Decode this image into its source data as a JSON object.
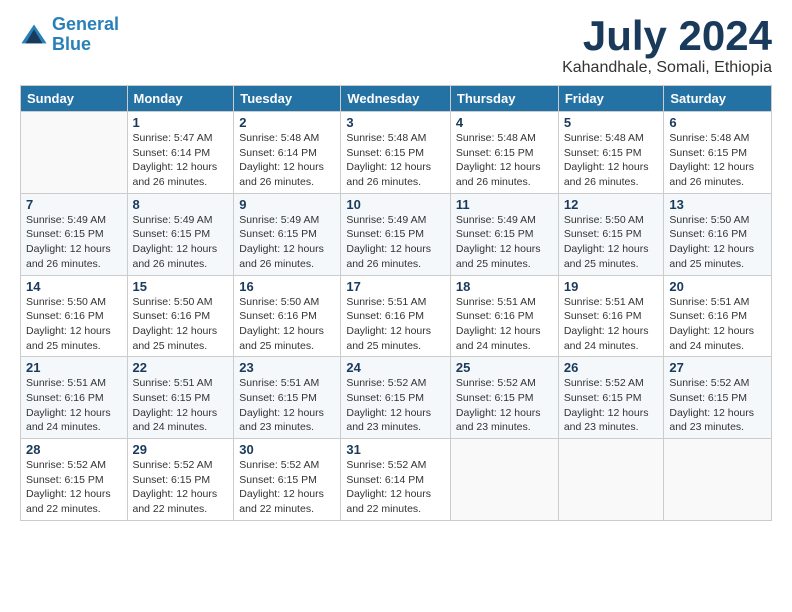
{
  "logo": {
    "line1": "General",
    "line2": "Blue"
  },
  "title": "July 2024",
  "subtitle": "Kahandhale, Somali, Ethiopia",
  "weekdays": [
    "Sunday",
    "Monday",
    "Tuesday",
    "Wednesday",
    "Thursday",
    "Friday",
    "Saturday"
  ],
  "weeks": [
    [
      {
        "day": "",
        "info": ""
      },
      {
        "day": "1",
        "info": "Sunrise: 5:47 AM\nSunset: 6:14 PM\nDaylight: 12 hours\nand 26 minutes."
      },
      {
        "day": "2",
        "info": "Sunrise: 5:48 AM\nSunset: 6:14 PM\nDaylight: 12 hours\nand 26 minutes."
      },
      {
        "day": "3",
        "info": "Sunrise: 5:48 AM\nSunset: 6:15 PM\nDaylight: 12 hours\nand 26 minutes."
      },
      {
        "day": "4",
        "info": "Sunrise: 5:48 AM\nSunset: 6:15 PM\nDaylight: 12 hours\nand 26 minutes."
      },
      {
        "day": "5",
        "info": "Sunrise: 5:48 AM\nSunset: 6:15 PM\nDaylight: 12 hours\nand 26 minutes."
      },
      {
        "day": "6",
        "info": "Sunrise: 5:48 AM\nSunset: 6:15 PM\nDaylight: 12 hours\nand 26 minutes."
      }
    ],
    [
      {
        "day": "7",
        "info": "Sunrise: 5:49 AM\nSunset: 6:15 PM\nDaylight: 12 hours\nand 26 minutes."
      },
      {
        "day": "8",
        "info": "Sunrise: 5:49 AM\nSunset: 6:15 PM\nDaylight: 12 hours\nand 26 minutes."
      },
      {
        "day": "9",
        "info": "Sunrise: 5:49 AM\nSunset: 6:15 PM\nDaylight: 12 hours\nand 26 minutes."
      },
      {
        "day": "10",
        "info": "Sunrise: 5:49 AM\nSunset: 6:15 PM\nDaylight: 12 hours\nand 26 minutes."
      },
      {
        "day": "11",
        "info": "Sunrise: 5:49 AM\nSunset: 6:15 PM\nDaylight: 12 hours\nand 25 minutes."
      },
      {
        "day": "12",
        "info": "Sunrise: 5:50 AM\nSunset: 6:15 PM\nDaylight: 12 hours\nand 25 minutes."
      },
      {
        "day": "13",
        "info": "Sunrise: 5:50 AM\nSunset: 6:16 PM\nDaylight: 12 hours\nand 25 minutes."
      }
    ],
    [
      {
        "day": "14",
        "info": "Sunrise: 5:50 AM\nSunset: 6:16 PM\nDaylight: 12 hours\nand 25 minutes."
      },
      {
        "day": "15",
        "info": "Sunrise: 5:50 AM\nSunset: 6:16 PM\nDaylight: 12 hours\nand 25 minutes."
      },
      {
        "day": "16",
        "info": "Sunrise: 5:50 AM\nSunset: 6:16 PM\nDaylight: 12 hours\nand 25 minutes."
      },
      {
        "day": "17",
        "info": "Sunrise: 5:51 AM\nSunset: 6:16 PM\nDaylight: 12 hours\nand 25 minutes."
      },
      {
        "day": "18",
        "info": "Sunrise: 5:51 AM\nSunset: 6:16 PM\nDaylight: 12 hours\nand 24 minutes."
      },
      {
        "day": "19",
        "info": "Sunrise: 5:51 AM\nSunset: 6:16 PM\nDaylight: 12 hours\nand 24 minutes."
      },
      {
        "day": "20",
        "info": "Sunrise: 5:51 AM\nSunset: 6:16 PM\nDaylight: 12 hours\nand 24 minutes."
      }
    ],
    [
      {
        "day": "21",
        "info": "Sunrise: 5:51 AM\nSunset: 6:16 PM\nDaylight: 12 hours\nand 24 minutes."
      },
      {
        "day": "22",
        "info": "Sunrise: 5:51 AM\nSunset: 6:15 PM\nDaylight: 12 hours\nand 24 minutes."
      },
      {
        "day": "23",
        "info": "Sunrise: 5:51 AM\nSunset: 6:15 PM\nDaylight: 12 hours\nand 23 minutes."
      },
      {
        "day": "24",
        "info": "Sunrise: 5:52 AM\nSunset: 6:15 PM\nDaylight: 12 hours\nand 23 minutes."
      },
      {
        "day": "25",
        "info": "Sunrise: 5:52 AM\nSunset: 6:15 PM\nDaylight: 12 hours\nand 23 minutes."
      },
      {
        "day": "26",
        "info": "Sunrise: 5:52 AM\nSunset: 6:15 PM\nDaylight: 12 hours\nand 23 minutes."
      },
      {
        "day": "27",
        "info": "Sunrise: 5:52 AM\nSunset: 6:15 PM\nDaylight: 12 hours\nand 23 minutes."
      }
    ],
    [
      {
        "day": "28",
        "info": "Sunrise: 5:52 AM\nSunset: 6:15 PM\nDaylight: 12 hours\nand 22 minutes."
      },
      {
        "day": "29",
        "info": "Sunrise: 5:52 AM\nSunset: 6:15 PM\nDaylight: 12 hours\nand 22 minutes."
      },
      {
        "day": "30",
        "info": "Sunrise: 5:52 AM\nSunset: 6:15 PM\nDaylight: 12 hours\nand 22 minutes."
      },
      {
        "day": "31",
        "info": "Sunrise: 5:52 AM\nSunset: 6:14 PM\nDaylight: 12 hours\nand 22 minutes."
      },
      {
        "day": "",
        "info": ""
      },
      {
        "day": "",
        "info": ""
      },
      {
        "day": "",
        "info": ""
      }
    ]
  ]
}
